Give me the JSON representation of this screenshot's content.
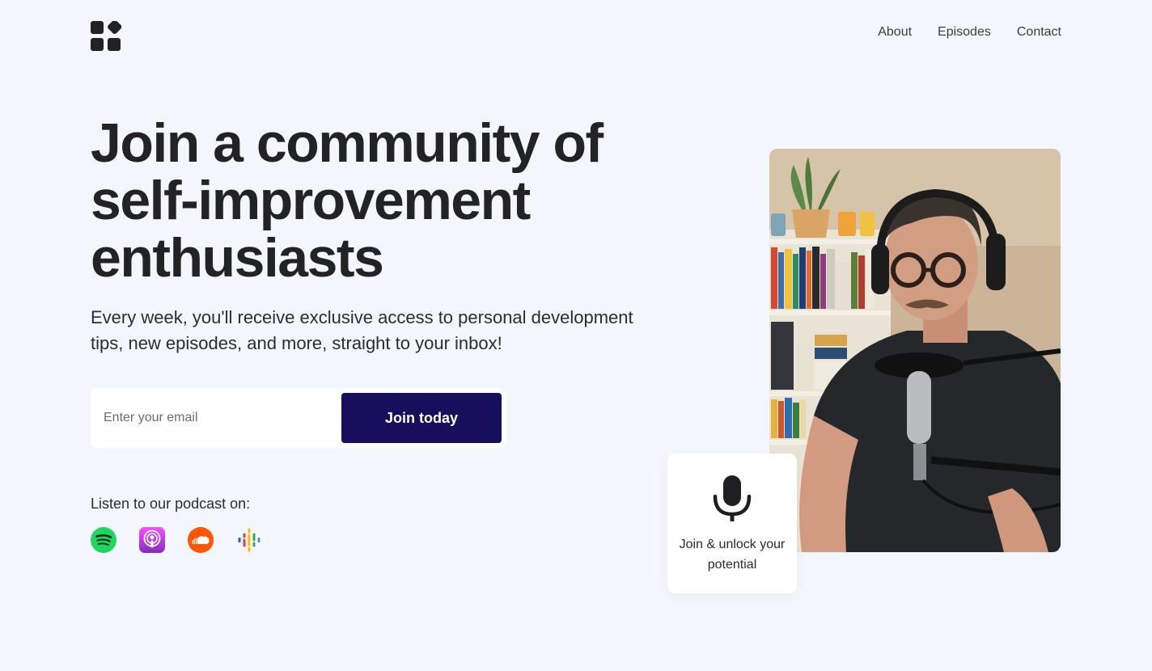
{
  "nav": {
    "items": [
      {
        "label": "About"
      },
      {
        "label": "Episodes"
      },
      {
        "label": "Contact"
      }
    ]
  },
  "hero": {
    "headline": "Join a community of self-improvement enthusiasts",
    "subtext": "Every week, you'll receive exclusive access to personal development tips, new episodes, and more, straight to your inbox!",
    "email_placeholder": "Enter your email",
    "email_value": "",
    "cta_label": "Join today",
    "listen_label": "Listen to our podcast on:",
    "platforms": [
      {
        "name": "spotify-icon",
        "color": "#1ed760"
      },
      {
        "name": "apple-podcasts-icon",
        "color": "#b150e2"
      },
      {
        "name": "soundcloud-icon",
        "color": "#ff5500"
      },
      {
        "name": "google-podcasts-icon",
        "color": "#4285f4"
      }
    ]
  },
  "card": {
    "icon": "microphone-icon",
    "text": "Join & unlock your potential"
  },
  "colors": {
    "background": "#f4f6fe",
    "button": "#170f5c",
    "text": "#232326"
  }
}
